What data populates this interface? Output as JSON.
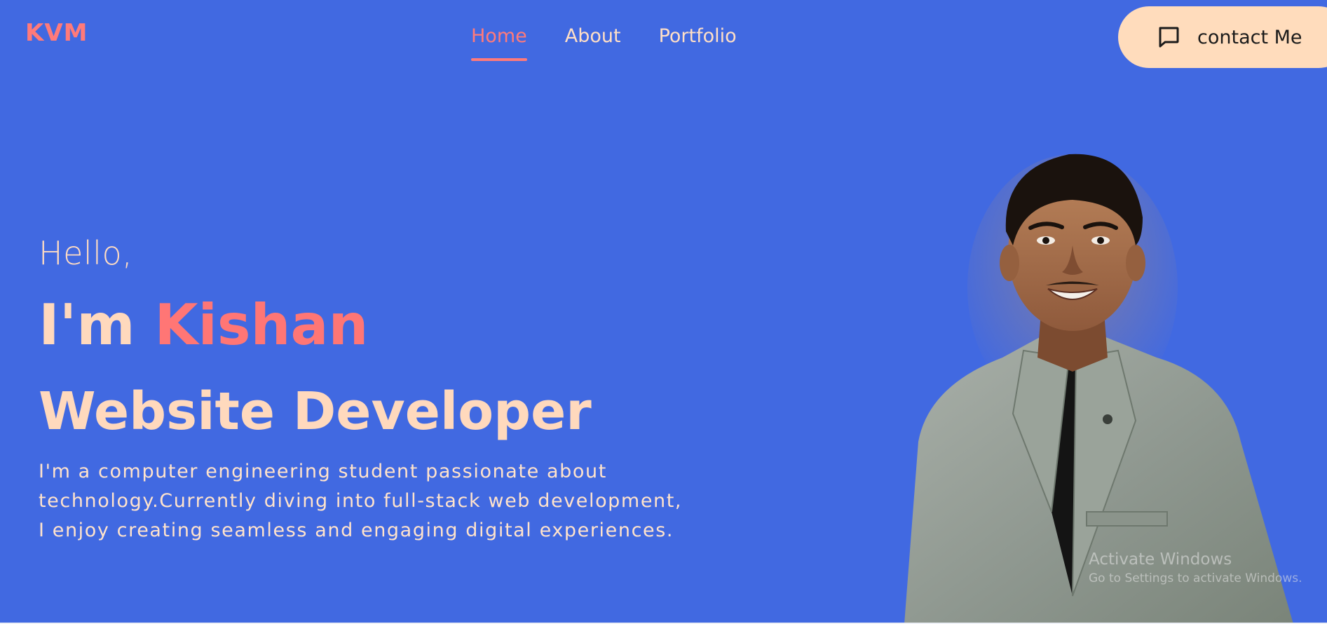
{
  "header": {
    "logo_text": "KVM",
    "nav": [
      {
        "label": "Home",
        "active": true
      },
      {
        "label": "About",
        "active": false
      },
      {
        "label": "Portfolio",
        "active": false
      }
    ],
    "contact_button": {
      "label": "contact Me",
      "icon": "chat-bubble-icon"
    }
  },
  "hero": {
    "greeting": "Hello,",
    "intro_prefix": "I'm",
    "name": "Kishan",
    "role": "Website Developer",
    "bio_lines": [
      "I'm a computer engineering student passionate about",
      "technology.Currently diving into full-stack web development,",
      "I enjoy creating seamless and engaging digital experiences."
    ],
    "portrait": "profile-photo"
  },
  "watermark": {
    "title": "Activate Windows",
    "subtitle": "Go to Settings to activate Windows."
  },
  "colors": {
    "background": "#4169e1",
    "accent": "#ff7a7a",
    "peach": "#ffdcbc"
  }
}
